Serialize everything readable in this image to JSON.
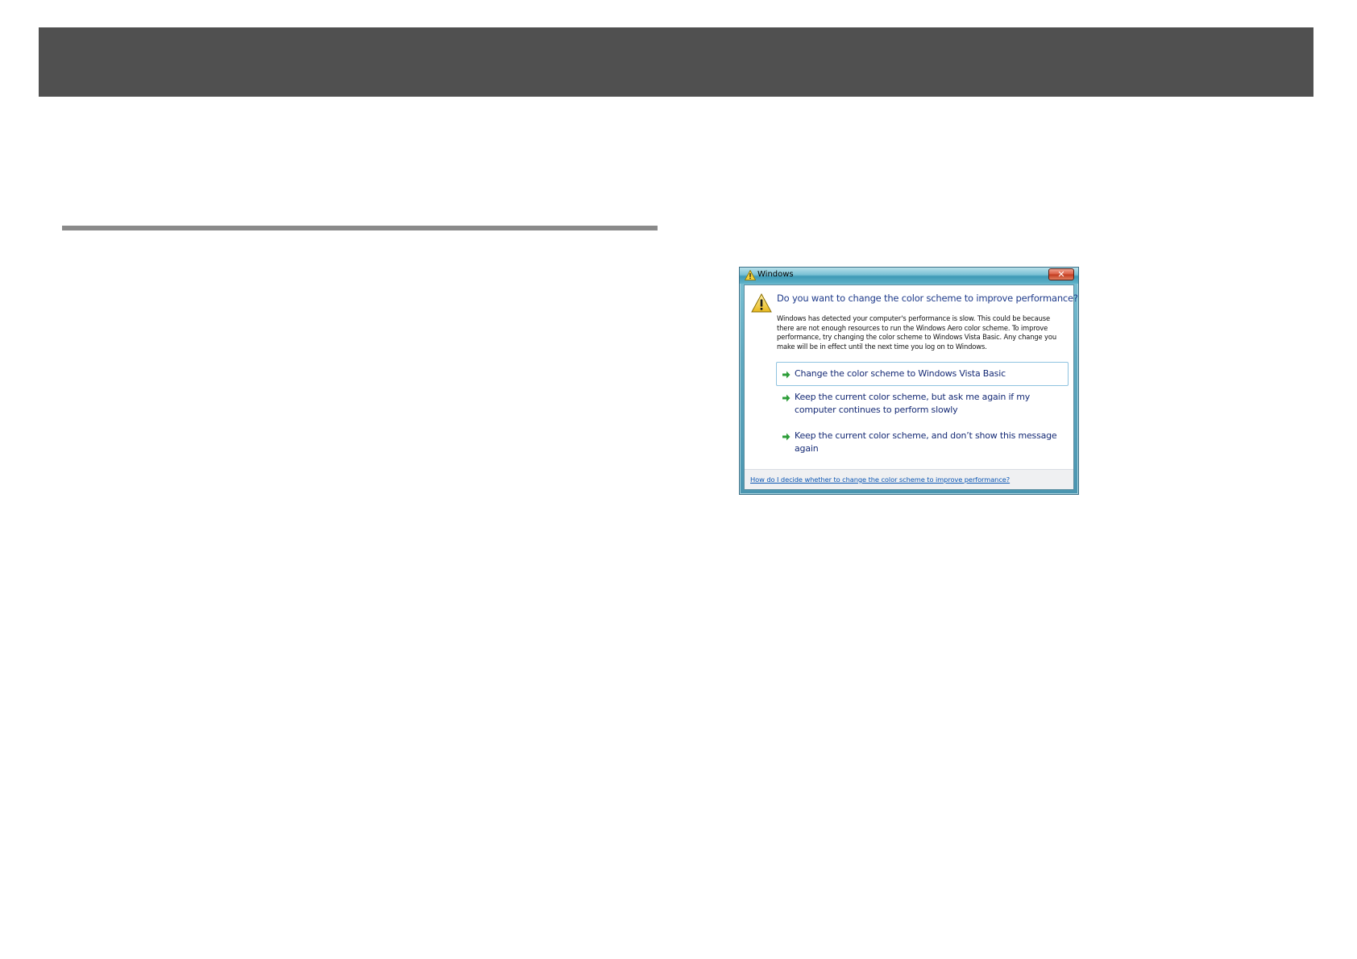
{
  "dialog": {
    "title": "Windows",
    "close_glyph": "✕",
    "main_instruction": "Do you want to change the color scheme to improve performance?",
    "content": "Windows has detected your computer's performance is slow. This could be because there are not enough resources to run the Windows Aero color scheme. To improve performance, try changing the color scheme to Windows Vista Basic. Any change you make will be in effect until the next time you log on to Windows.",
    "options": [
      {
        "label": "Change the color scheme to Windows Vista Basic",
        "selected": true
      },
      {
        "label": "Keep the current color scheme, but ask me again if my computer continues to perform slowly",
        "selected": false
      },
      {
        "label": "Keep the current color scheme, and don’t show this message again",
        "selected": false
      }
    ],
    "footer_link": "How do I decide whether to change the color scheme to improve performance?",
    "icons": {
      "title": "warning-icon",
      "main": "warning-icon",
      "option": "green-arrow-icon"
    },
    "colors": {
      "instruction_text": "#1e3a8a",
      "link": "#0a55b3",
      "arrow": "#2e9e3a",
      "title_bar": "#5fb3c9"
    }
  },
  "page": {
    "header_band_color": "#505050",
    "rule_color": "#8a8a8a"
  }
}
